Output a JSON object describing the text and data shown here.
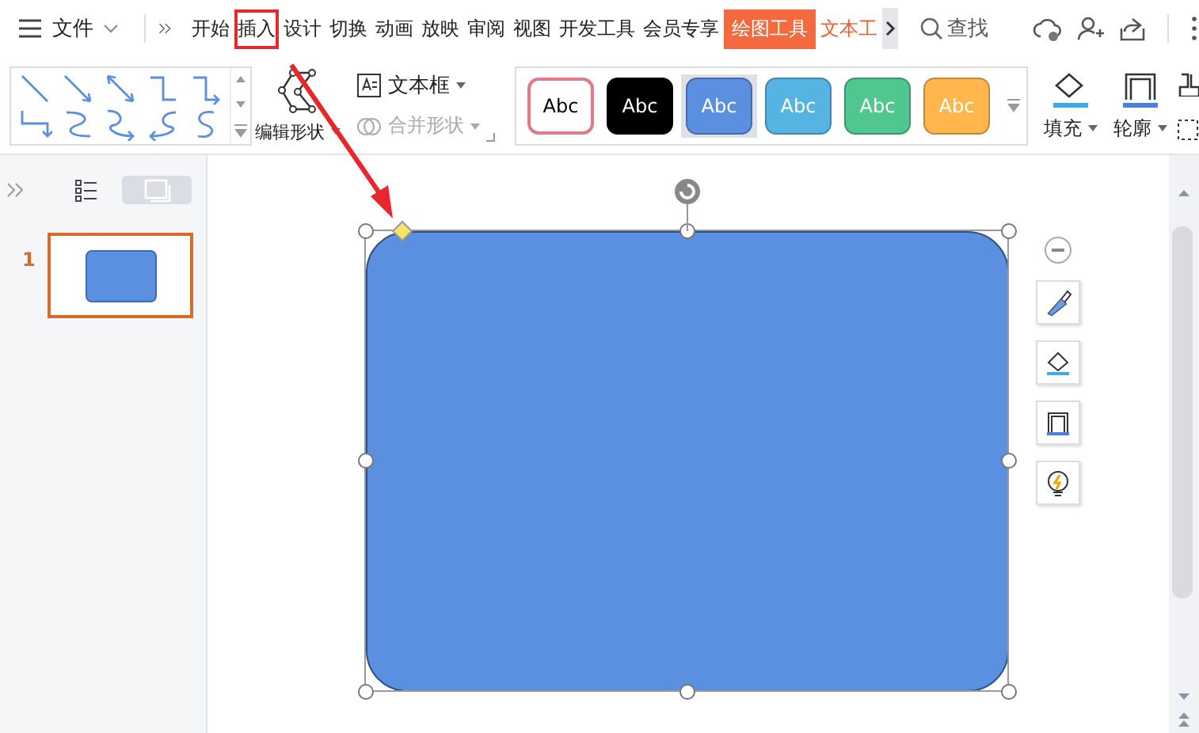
{
  "menu": {
    "file_label": "文件"
  },
  "tabs": [
    {
      "label": "开始",
      "kind": "normal",
      "selected": false,
      "annotated": false
    },
    {
      "label": "插入",
      "kind": "normal",
      "selected": false,
      "annotated": true
    },
    {
      "label": "设计",
      "kind": "normal",
      "selected": false,
      "annotated": false
    },
    {
      "label": "切换",
      "kind": "normal",
      "selected": false,
      "annotated": false
    },
    {
      "label": "动画",
      "kind": "normal",
      "selected": false,
      "annotated": false
    },
    {
      "label": "放映",
      "kind": "normal",
      "selected": false,
      "annotated": false
    },
    {
      "label": "审阅",
      "kind": "normal",
      "selected": false,
      "annotated": false
    },
    {
      "label": "视图",
      "kind": "normal",
      "selected": false,
      "annotated": false
    },
    {
      "label": "开发工具",
      "kind": "normal",
      "selected": false,
      "annotated": false
    },
    {
      "label": "会员专享",
      "kind": "normal",
      "selected": false,
      "annotated": false
    },
    {
      "label": "绘图工具",
      "kind": "contextual",
      "selected": true,
      "annotated": false
    },
    {
      "label": "文本工",
      "kind": "contextual",
      "selected": false,
      "annotated": false
    }
  ],
  "search": {
    "label": "查找"
  },
  "ribbon": {
    "edit_shape": "编辑形状",
    "text_box": "文本框",
    "merge_shape": {
      "label": "合并形状",
      "disabled": true
    },
    "styles": [
      {
        "label": "Abc",
        "kind": "outline",
        "color": "#e07a8a",
        "selected": false
      },
      {
        "label": "Abc",
        "kind": "filled",
        "color": "#000000",
        "selected": false
      },
      {
        "label": "Abc",
        "kind": "filled",
        "color": "#5b8fe0",
        "selected": true
      },
      {
        "label": "Abc",
        "kind": "filled",
        "color": "#56b4e3",
        "selected": false
      },
      {
        "label": "Abc",
        "kind": "filled",
        "color": "#4fc78f",
        "selected": false
      },
      {
        "label": "Abc",
        "kind": "filled",
        "color": "#ffb74d",
        "selected": false
      }
    ],
    "fill": "填充",
    "outline": "轮廓"
  },
  "panel_views": [
    {
      "kind": "list",
      "selected": false
    },
    {
      "kind": "thumbnail",
      "selected": true
    }
  ],
  "slides": [
    {
      "number": "1",
      "selected": true
    }
  ]
}
